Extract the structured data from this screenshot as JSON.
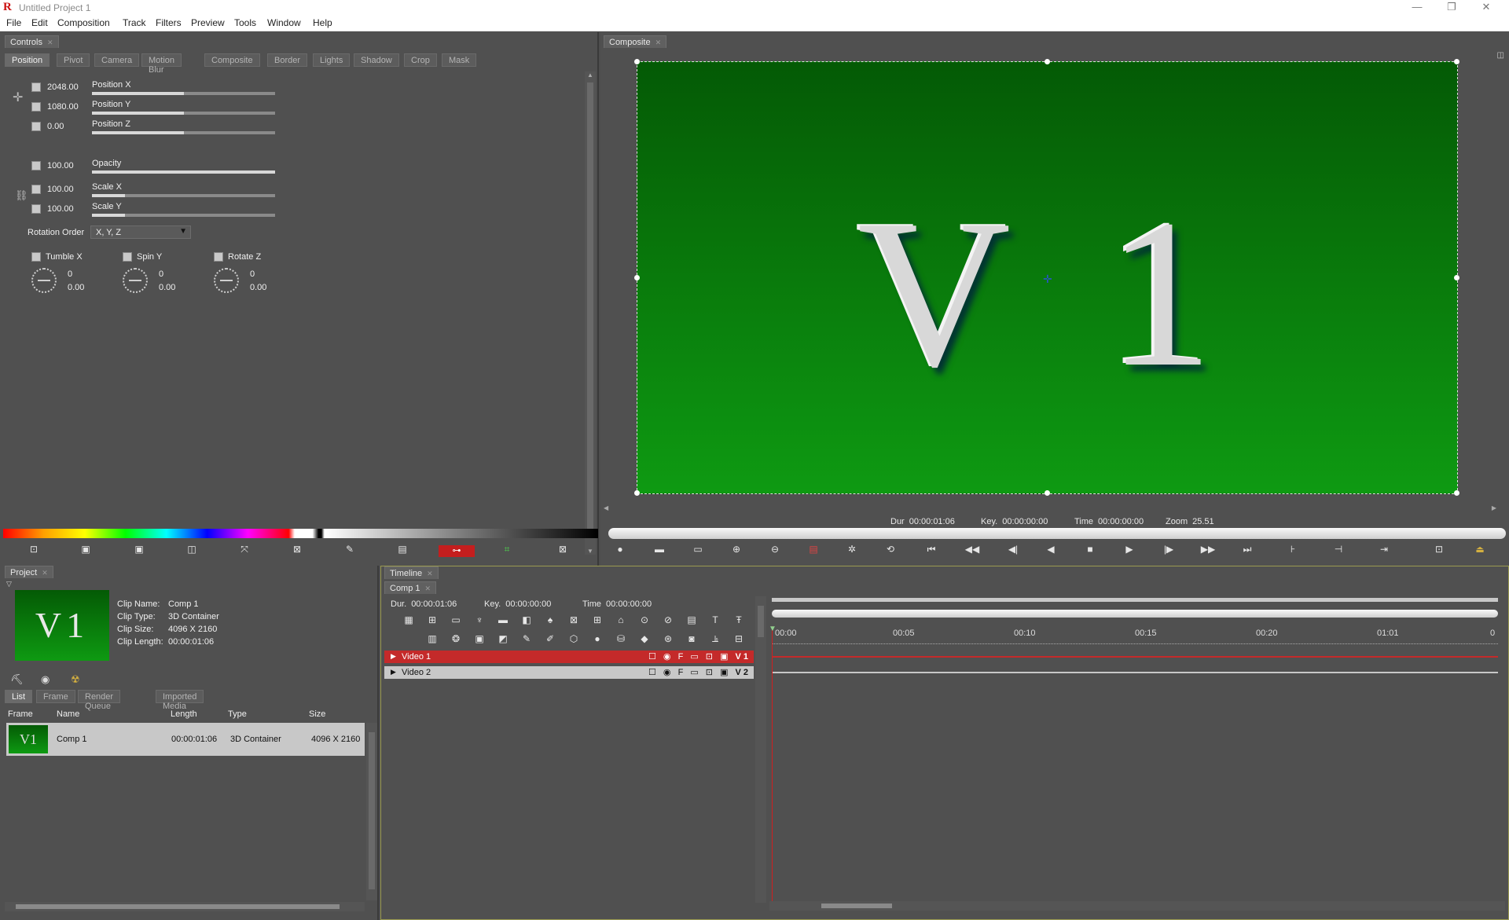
{
  "window": {
    "title": "Untitled Project 1",
    "logo": "R",
    "minimize": "—",
    "restore": "❐",
    "close": "✕"
  },
  "menu": [
    "File",
    "Edit",
    "Composition",
    "Track",
    "Filters",
    "Preview",
    "Tools",
    "Window",
    "Help"
  ],
  "controls": {
    "panel_title": "Controls",
    "tabs": [
      "Position",
      "Pivot",
      "Camera",
      "Motion Blur",
      "Composite",
      "Border",
      "Lights",
      "Shadow",
      "Crop",
      "Mask"
    ],
    "params": [
      {
        "value": "2048.00",
        "label": "Position X",
        "level": 0.5
      },
      {
        "value": "1080.00",
        "label": "Position Y",
        "level": 0.5
      },
      {
        "value": "0.00",
        "label": "Position Z",
        "level": 0.5
      },
      {
        "value": "100.00",
        "label": "Opacity",
        "level": 1.0
      },
      {
        "value": "100.00",
        "label": "Scale X",
        "level": 0.18
      },
      {
        "value": "100.00",
        "label": "Scale Y",
        "level": 0.18
      }
    ],
    "rotation_order_label": "Rotation Order",
    "rotation_order_value": "X, Y, Z",
    "rotations": [
      {
        "label": "Tumble X",
        "turns": "0",
        "degrees": "0.00"
      },
      {
        "label": "Spin Y",
        "turns": "0",
        "degrees": "0.00"
      },
      {
        "label": "Rotate Z",
        "turns": "0",
        "degrees": "0.00"
      }
    ]
  },
  "composite": {
    "panel_title": "Composite",
    "canvas_text": "V 1",
    "dur_label": "Dur",
    "dur": "00:00:01:06",
    "key_label": "Key.",
    "key": "00:00:00:00",
    "time_label": "Time",
    "time": "00:00:00:00",
    "zoom_label": "Zoom",
    "zoom": "25.51"
  },
  "project": {
    "panel_title": "Project",
    "thumb_text": "V1",
    "clip_name_label": "Clip Name:",
    "clip_name": "Comp 1",
    "clip_type_label": "Clip Type:",
    "clip_type": "3D Container",
    "clip_size_label": "Clip Size:",
    "clip_size": "4096 X 2160",
    "clip_length_label": "Clip Length:",
    "clip_length": "00:00:01:06",
    "tabs": [
      "List",
      "Frame",
      "Render Queue",
      "Imported Media"
    ],
    "columns": [
      "Frame",
      "Name",
      "Length",
      "Type",
      "Size"
    ],
    "rows": [
      {
        "thumb": "V1",
        "name": "Comp 1",
        "length": "00:00:01:06",
        "type": "3D Container",
        "size": "4096 X 2160"
      }
    ]
  },
  "timeline": {
    "panel_title": "Timeline",
    "comp_tab": "Comp 1",
    "dur_label": "Dur.",
    "dur": "00:00:01:06",
    "key_label": "Key.",
    "key": "00:00:00:00",
    "time_label": "Time",
    "time": "00:00:00:00",
    "ticks": [
      "00:00",
      "00:05",
      "00:10",
      "00:15",
      "00:20",
      "01:01",
      "0"
    ],
    "tracks": [
      {
        "name": "Video 1",
        "tag": "V1",
        "color": "#c42a2a"
      },
      {
        "name": "Video 2",
        "tag": "V2",
        "color": "#c8c8c8"
      }
    ]
  },
  "colors": {
    "accent_red": "#c42a2a",
    "canvas_green_top": "#045a05",
    "canvas_green_bottom": "#0e9a12",
    "panel_bg": "#505050"
  }
}
